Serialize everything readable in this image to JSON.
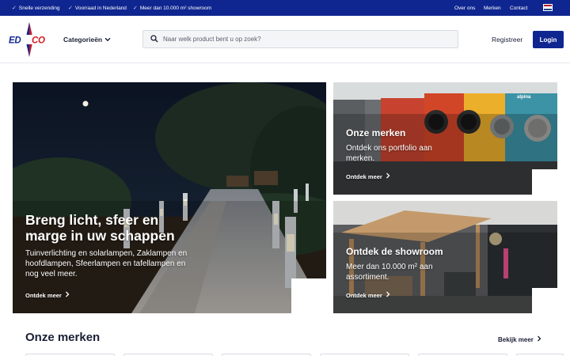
{
  "topbar": {
    "usps": [
      "Snelle verzending",
      "Voorraad in Nederland",
      "Meer dan 10.000 m² showroom"
    ],
    "links": [
      "Over ons",
      "Merken",
      "Contact"
    ],
    "flag_colors": [
      "#ae1c28",
      "#ffffff",
      "#21468b"
    ]
  },
  "header": {
    "logo_text": "EDCO",
    "categories_label": "Categorieën",
    "search_placeholder": "Naar welk product bent u op zoek?",
    "register_label": "Registreer",
    "login_label": "Login"
  },
  "hero": {
    "main": {
      "title": "Breng licht, sfeer en marge in uw schappen",
      "text": "Tuinverlichting en solarlampen, Zaklampen en hoofdlampen, Sfeerlampen en tafellampen en nog veel meer.",
      "link": "Ontdek meer"
    },
    "brands": {
      "title": "Onze merken",
      "text": "Ontdek ons portfolio aan merken.",
      "link": "Ontdek meer",
      "sign": "alpina"
    },
    "showroom": {
      "title": "Ontdek de showroom",
      "text": "Meer dan 10.000 m² aan assortiment.",
      "link": "Ontdek meer"
    }
  },
  "brands_section": {
    "title": "Onze merken",
    "see_all": "Bekijk meer"
  },
  "colors": {
    "brand_blue": "#0f2690",
    "logo_red": "#d71920",
    "text_dark": "#1a1f36"
  }
}
